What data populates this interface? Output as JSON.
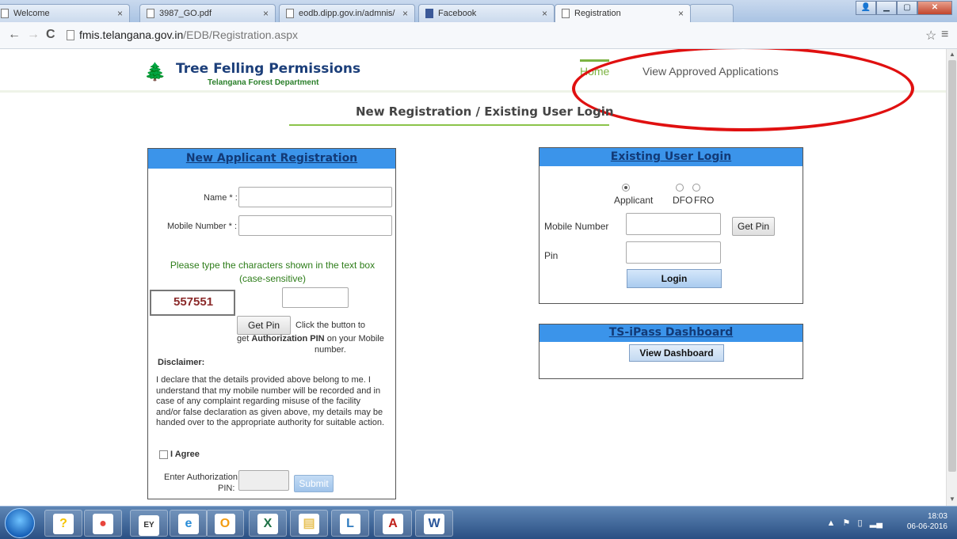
{
  "browser": {
    "tabs": [
      {
        "title": "Welcome",
        "icon": "page-icon"
      },
      {
        "title": "3987_GO.pdf",
        "icon": "page-icon"
      },
      {
        "title": "eodb.dipp.gov.in/admnis/",
        "icon": "page-icon"
      },
      {
        "title": "Facebook",
        "icon": "facebook-icon"
      },
      {
        "title": "Registration",
        "icon": "page-icon"
      }
    ],
    "tab_close_glyph": "×",
    "url_host": "fmis.telangana.gov.in",
    "url_path": "/EDB/Registration.aspx"
  },
  "site": {
    "title": "Tree Felling Permissions",
    "subtitle": "Telangana Forest Department",
    "nav": {
      "home": "Home",
      "approved": "View Approved Applications"
    },
    "page_heading": "New Registration / Existing User Login"
  },
  "registration": {
    "heading": "New Applicant Registration",
    "name_label": "Name * :",
    "mobile_label": "Mobile Number * :",
    "captcha_prompt_1": "Please type the characters shown in the text box",
    "captcha_prompt_2": "(case-sensitive)",
    "captcha_value": "557551",
    "get_pin_label": "Get Pin",
    "pin_hint_1": "Click the button to",
    "pin_hint_2a": "get ",
    "pin_hint_bold": "Authorization PIN",
    "pin_hint_2b": " on your Mobile",
    "pin_hint_3": "number.",
    "disclaimer_title": "Disclaimer:",
    "disclaimer_text": "I declare that the details provided above belong to me. I understand that my mobile number will be recorded and in case of any complaint regarding misuse of the facility and/or false declaration as given above, my details may be handed over to the appropriate authority for suitable action.",
    "agree_label": "I Agree",
    "auth_pin_label_1": "Enter Authorization",
    "auth_pin_label_2": "PIN:",
    "submit_label": "Submit"
  },
  "login": {
    "heading": "Existing User Login",
    "roles": [
      "Applicant",
      "DFO",
      "FRO"
    ],
    "selected_role": "Applicant",
    "mobile_label": "Mobile Number",
    "get_pin_label": "Get Pin",
    "pin_label": "Pin",
    "login_label": "Login"
  },
  "tsipass": {
    "heading": "TS-iPass Dashboard",
    "view_label": "View Dashboard"
  },
  "taskbar": {
    "time": "18:03",
    "date": "06-06-2016",
    "apps": [
      {
        "name": "help-icon",
        "glyph": "?",
        "color": "#f5c400"
      },
      {
        "name": "chrome-icon",
        "glyph": "●",
        "color": "#e8453c"
      },
      {
        "name": "ey-discover-icon",
        "glyph": "EY",
        "color": "#333333"
      },
      {
        "name": "ie-icon",
        "glyph": "e",
        "color": "#2a8dd8"
      },
      {
        "name": "outlook-icon",
        "glyph": "O",
        "color": "#f39c12"
      },
      {
        "name": "excel-icon",
        "glyph": "X",
        "color": "#1e7145"
      },
      {
        "name": "explorer-icon",
        "glyph": "▤",
        "color": "#e8c35a"
      },
      {
        "name": "lync-icon",
        "glyph": "L",
        "color": "#2f7bbf"
      },
      {
        "name": "acrobat-icon",
        "glyph": "A",
        "color": "#c0201a"
      },
      {
        "name": "word-icon",
        "glyph": "W",
        "color": "#2b579a"
      }
    ]
  }
}
